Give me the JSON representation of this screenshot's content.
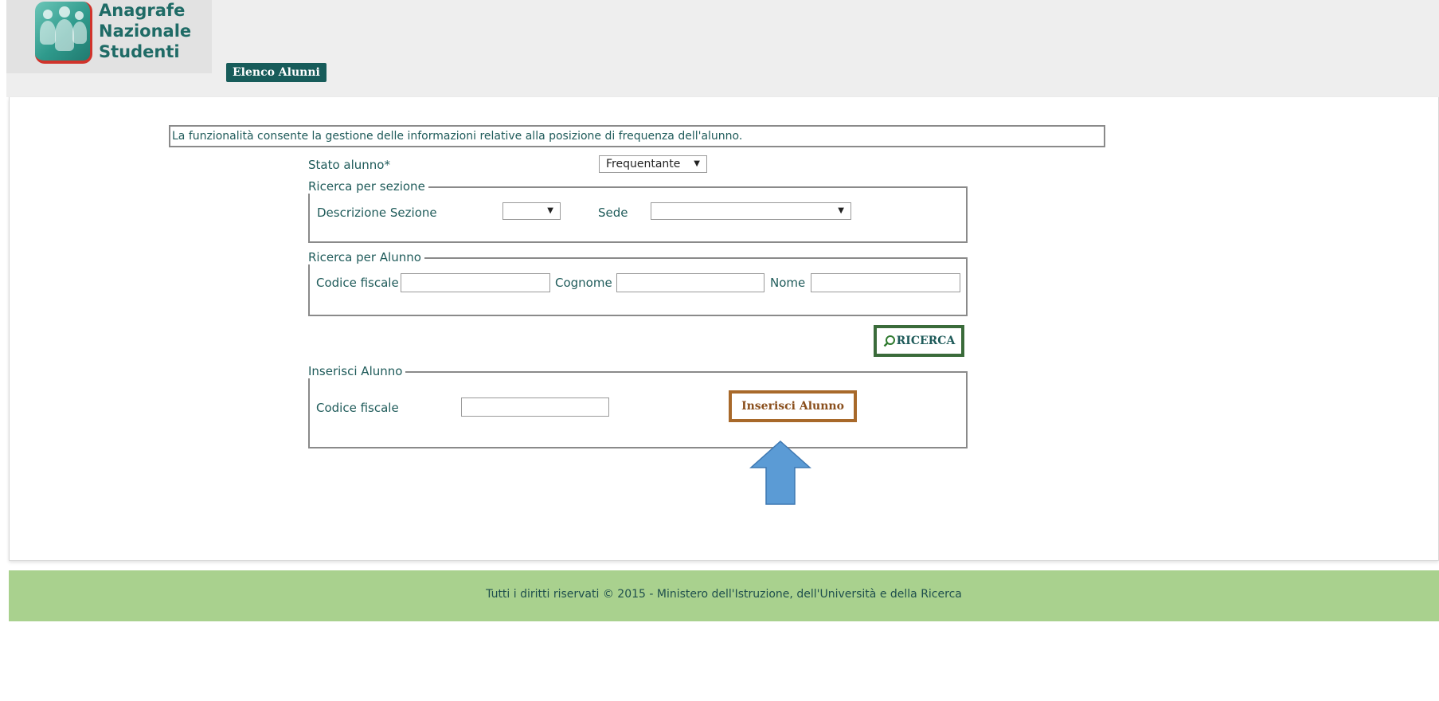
{
  "app": {
    "logo_lines": [
      "Anagrafe",
      "Nazionale",
      "Studenti"
    ],
    "tab_label": "Elenco Alunni"
  },
  "info": {
    "text": "La funzionalità consente la gestione delle informazioni relative alla posizione di frequenza dell'alunno."
  },
  "stato": {
    "label": "Stato alunno*",
    "selected": "Frequentante"
  },
  "ricerca_sezione": {
    "legend": "Ricerca per sezione",
    "descrizione_label": "Descrizione Sezione",
    "descrizione_value": "",
    "sede_label": "Sede",
    "sede_value": ""
  },
  "ricerca_alunno": {
    "legend": "Ricerca per Alunno",
    "codice_label": "Codice fiscale",
    "cognome_label": "Cognome",
    "nome_label": "Nome",
    "codice_value": "",
    "cognome_value": "",
    "nome_value": ""
  },
  "ricerca_button": "RICERCA",
  "inserisci": {
    "legend": "Inserisci Alunno",
    "codice_label": "Codice fiscale",
    "codice_value": "",
    "button": "Inserisci Alunno"
  },
  "footer": {
    "text": "Tutti i diritti riservati © 2015 -  Ministero dell'Istruzione, dell'Università e della Ricerca"
  },
  "colors": {
    "header_bg": "#eeeeee",
    "tab_bg": "#175c5a",
    "text": "#1f5b5a",
    "ricerca_border": "#3a6b3a",
    "inserisci_border": "#a8692a",
    "annotation_arrow": "#5b9bd5",
    "footer_bg": "#a9d18e"
  },
  "icons": {
    "logo": "students-group-icon",
    "dropdown": "dropdown-arrow-icon",
    "search": "magnifier-icon",
    "annotation": "up-arrow-icon"
  }
}
